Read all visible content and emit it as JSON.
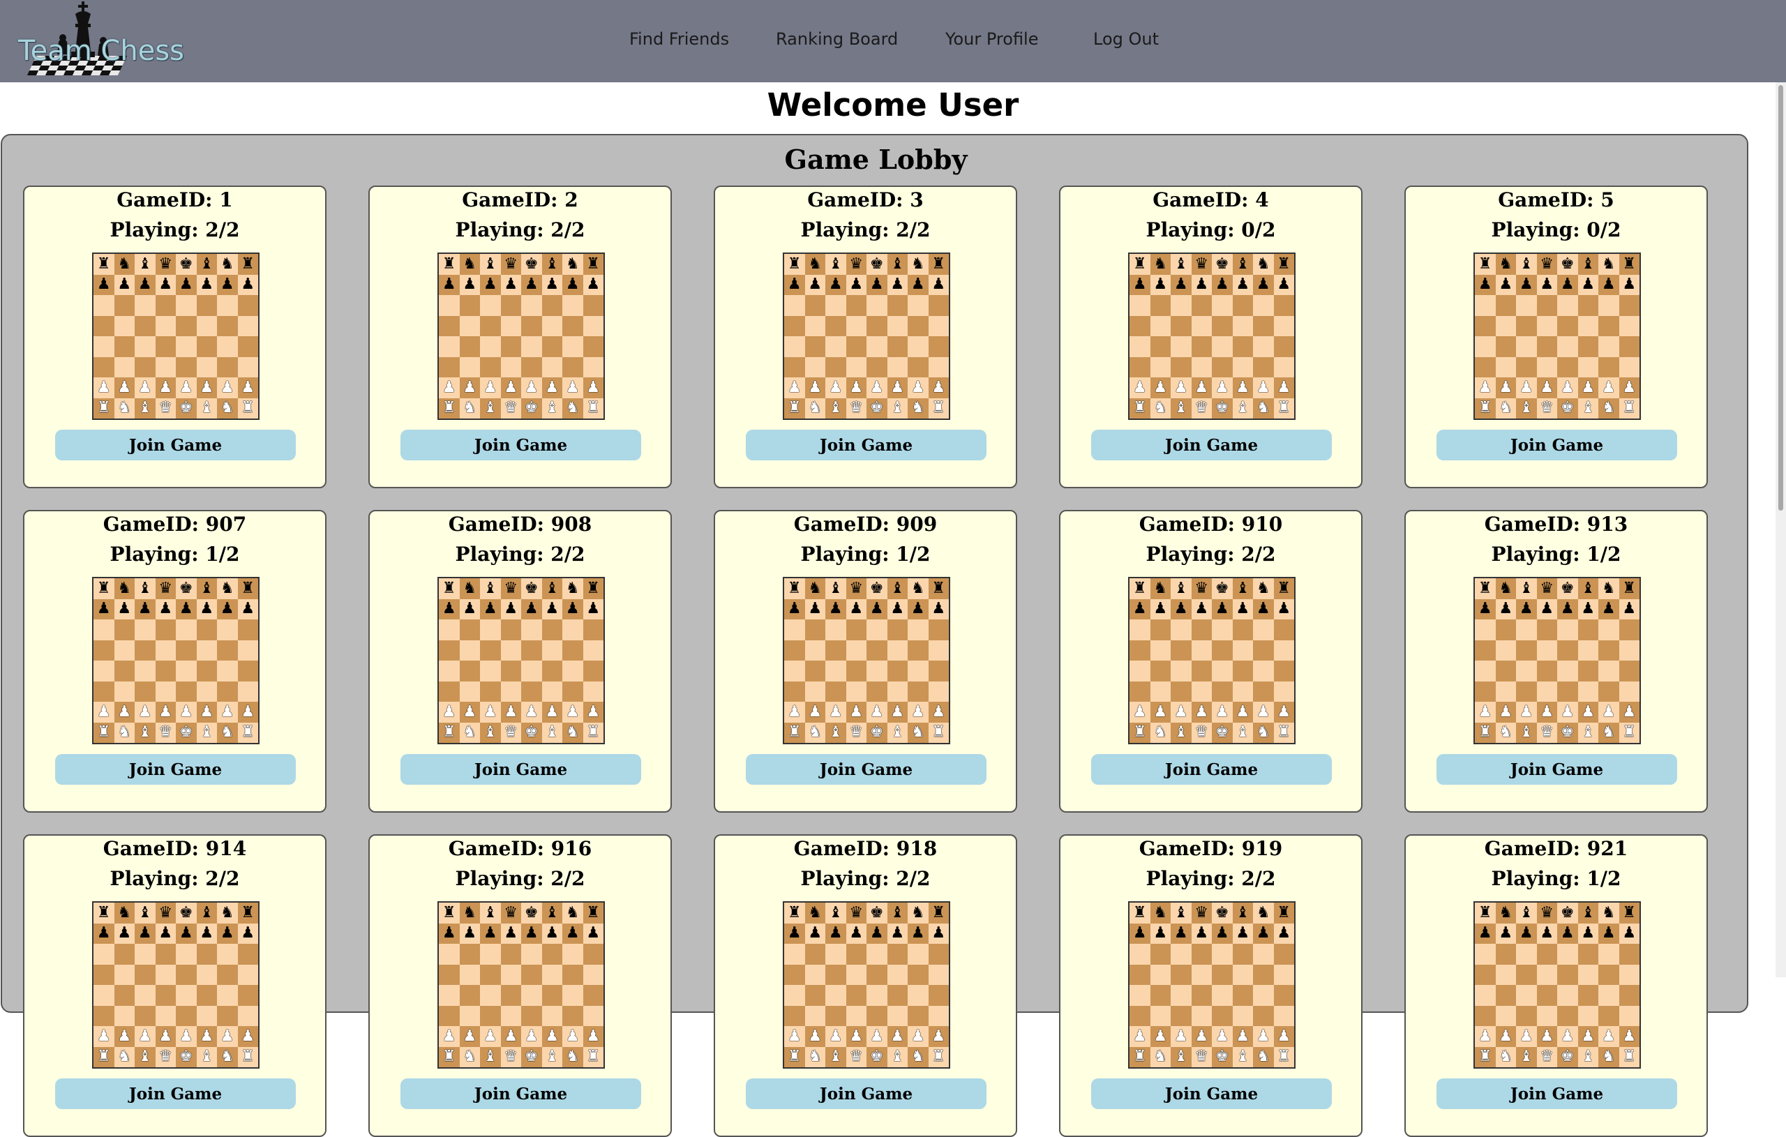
{
  "header": {
    "logo_text": "Team Chess",
    "nav": [
      "Find Friends",
      "Ranking Board",
      "Your Profile",
      "Log Out"
    ]
  },
  "welcome": "Welcome User",
  "lobby": {
    "title": "Game Lobby",
    "join_label": "Join Game",
    "games": [
      {
        "id": "GameID: 1",
        "playing": "Playing: 2/2"
      },
      {
        "id": "GameID: 2",
        "playing": "Playing: 2/2"
      },
      {
        "id": "GameID: 3",
        "playing": "Playing: 2/2"
      },
      {
        "id": "GameID: 4",
        "playing": "Playing: 0/2"
      },
      {
        "id": "GameID: 5",
        "playing": "Playing: 0/2"
      },
      {
        "id": "GameID: 907",
        "playing": "Playing: 1/2"
      },
      {
        "id": "GameID: 908",
        "playing": "Playing: 2/2"
      },
      {
        "id": "GameID: 909",
        "playing": "Playing: 1/2"
      },
      {
        "id": "GameID: 910",
        "playing": "Playing: 2/2"
      },
      {
        "id": "GameID: 913",
        "playing": "Playing: 1/2"
      },
      {
        "id": "GameID: 914",
        "playing": "Playing: 2/2"
      },
      {
        "id": "GameID: 916",
        "playing": "Playing: 2/2"
      },
      {
        "id": "GameID: 918",
        "playing": "Playing: 2/2"
      },
      {
        "id": "GameID: 919",
        "playing": "Playing: 2/2"
      },
      {
        "id": "GameID: 921",
        "playing": "Playing: 1/2"
      }
    ]
  },
  "board": {
    "back_rank": [
      "♜",
      "♞",
      "♝",
      "♛",
      "♚",
      "♝",
      "♞",
      "♜"
    ],
    "pawn": "♟",
    "colors": {
      "dark": "#cb9454",
      "light": "#fbd6ad"
    }
  },
  "theme": {
    "topbar": "#747887",
    "lobby_bg": "#bcbcbc",
    "card_bg": "#ffffe2",
    "button_bg": "#add8e6"
  }
}
